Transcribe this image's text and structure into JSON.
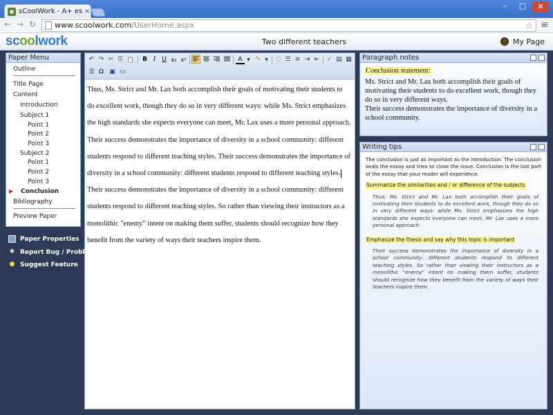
{
  "browser": {
    "tab_title": "sCoolWork - A+ essay in hal",
    "tab_close": "×",
    "url_domain": "www.scoolwork.com",
    "url_path": "/UserHome.aspx",
    "controls": {
      "minimize": "–",
      "maximize": "□",
      "close": "✕",
      "back": "←",
      "forward": "→",
      "reload": "↻",
      "star": "☆",
      "menu": "≡"
    }
  },
  "app": {
    "logo_start": "sc",
    "logo_oo": "oo",
    "logo_end": "lwork",
    "doc_title": "Two different teachers",
    "my_page": "My Page"
  },
  "paper_menu": {
    "title": "Paper Menu",
    "items": [
      {
        "label": "Outline"
      },
      {
        "label": "Title Page"
      },
      {
        "label": "Content"
      },
      {
        "label": "Introduction"
      },
      {
        "label": "Subject 1"
      },
      {
        "label": "Point 1"
      },
      {
        "label": "Point 2"
      },
      {
        "label": "Point 3"
      },
      {
        "label": "Subject 2"
      },
      {
        "label": "Point 1"
      },
      {
        "label": "Point 2"
      },
      {
        "label": "Point 3"
      },
      {
        "label": "Conclusion"
      },
      {
        "label": "Bibliography"
      },
      {
        "label": "Preview Paper"
      }
    ],
    "active_arrow": "▶"
  },
  "left_tools": {
    "paper_properties": "Paper Properties",
    "report_bug": "Report  Bug / Problem",
    "suggest_feature": "Suggest Feature"
  },
  "editor": {
    "toolbar_glyphs": {
      "undo": "↶",
      "redo": "↷",
      "cut": "✂",
      "copy": "⎘",
      "paste": "📋",
      "bold": "B",
      "italic": "I",
      "underline": "U",
      "subscript": "x₂",
      "superscript": "x²",
      "font_color": "A",
      "highlight": "✎",
      "bullets": "☰",
      "numbers": "≡",
      "indent": "⇥",
      "outdent": "⇤",
      "spell": "✓",
      "special_char": "Ω"
    },
    "text_before_caret": "Thus, Ms. Strict and Mr. Lax both accomplish their goals of motivating their students to do excellent work, though they do so in very different ways: while Ms. Strict emphasizes the high standards she expects everyone can meet, Mr. Lax uses a more personal approach. Their success demonstrates the importance of diversity in a school community: different students respond to different teaching styles. Their success demonstrates the importance of diversity in a school community: different students respond to different teaching styles.",
    "text_after_caret": "Their success demonstrates the importance of diversity in a school community: different students respond to different teaching styles. So rather than viewing their instructors as a monolithic \"enemy\" intent on making them suffer, students should recognize how they benefit from the variety of ways their teachers inspire them."
  },
  "paragraph_notes": {
    "title": "Paragraph notes",
    "label": "Conclusion statement:",
    "text1": "Ms. Strict and Mr. Lax both accomplish their goals of motivating their students to do excellent work, though they do so in very different ways.",
    "text2": "Their success demonstrates the importance of diversity in a school community."
  },
  "writing_tips": {
    "title": "Writing tips",
    "intro": "The conclusion is just as important as the introduction. The conclusion seals the essay and tries to close the issue. Conclusion is the last part of the essay that your reader will experience.",
    "tip1": "Summarize the similarities and / or difference of the subjects",
    "quote1": "Thus, Ms. Strict and Mr. Lax both accomplish their goals of motivating their students to do excellent work, though they do so in very different ways: while Ms. Strict emphasizes the high standards she expects everyone can meet, Mr. Lax uses a more personal approach.",
    "tip2": "Emphasize the thesis and say why this topic is important",
    "quote2": "Their success demonstrates the importance of diversity in a school community: different students respond to different teaching styles. So rather than viewing their instructors as a monolithic \"enemy\" intent on making them suffer, students should recognize how they benefit from the variety of ways their teachers inspire them."
  }
}
